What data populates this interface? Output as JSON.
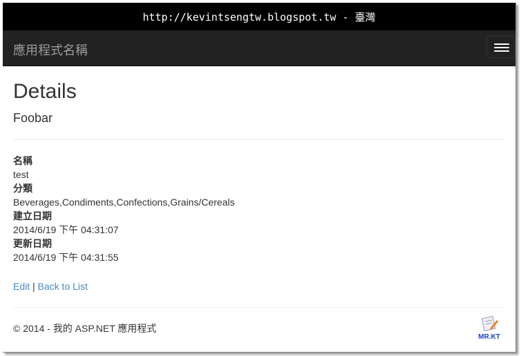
{
  "banner": {
    "text": "http://kevintsengtw.blogspot.tw - 臺灣"
  },
  "navbar": {
    "brand": "應用程式名稱"
  },
  "page": {
    "title": "Details",
    "subtitle": "Foobar"
  },
  "fields": [
    {
      "label": "名稱",
      "value": "test"
    },
    {
      "label": "分類",
      "value": "Beverages,Condiments,Confections,Grains/Cereals"
    },
    {
      "label": "建立日期",
      "value": "2014/6/19 下午 04:31:07"
    },
    {
      "label": "更新日期",
      "value": "2014/6/19 下午 04:31:55"
    }
  ],
  "links": {
    "edit": "Edit",
    "separator": " | ",
    "back": "Back to List"
  },
  "footer": {
    "text": "© 2014 - 我的 ASP.NET 應用程式"
  },
  "logo": {
    "text": "MR.KT"
  }
}
